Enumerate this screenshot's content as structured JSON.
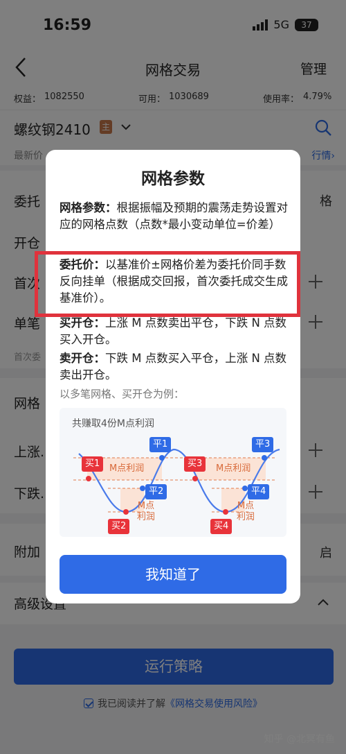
{
  "status": {
    "time": "16:59",
    "network": "5G",
    "battery": "37"
  },
  "nav": {
    "title": "网格交易",
    "manage": "管理"
  },
  "account": {
    "equity_label": "权益：",
    "equity": "1082550",
    "available_label": "可用：",
    "available": "1030689",
    "usage_label": "使用率：",
    "usage": "4.79%"
  },
  "contract": {
    "name": "螺纹钢2410",
    "tag": "主"
  },
  "price": {
    "latest_label": "最新价",
    "quote_link": "行情›"
  },
  "form": {
    "row1": "委托",
    "row1_right": "格",
    "row2": "开仓",
    "row3": "首次",
    "row4": "单笔",
    "row5": "首次委",
    "section": "网格",
    "up": "上涨.",
    "down": "下跌.",
    "extra": "附加",
    "extra_right": "启",
    "advanced": "高级设置"
  },
  "run_button": "运行策略",
  "agreement": {
    "prefix": "我已阅读并了解",
    "link": "《网格交易使用风险》"
  },
  "watermark": "知乎 @北冥有鱼",
  "modal": {
    "title": "网格参数",
    "p1_head": "网格参数：",
    "p1_body": "根据振幅及预期的震荡走势设置对应的网格点数（点数*最小变动单位=价差）",
    "p2_head": "委托价：",
    "p2_body": "以基准价±网格价差为委托价同手数反向挂单（根据成交回报，首次委托成交生成基准价）。",
    "p3_head": "买开仓：",
    "p3_body": "上涨 M 点数卖出平仓，下跌 N 点数买入开仓。",
    "p4_head": "卖开仓：",
    "p4_body": "下跌 M 点数买入平仓，上涨 N 点数卖出开仓。",
    "caption": "以多笔网格、买开仓为例：",
    "diagram_title": "共赚取4份M点利润",
    "tags": {
      "b1": "买1",
      "b2": "买2",
      "b3": "买3",
      "b4": "买4",
      "c1": "平1",
      "c2": "平2",
      "c3": "平3",
      "c4": "平4"
    },
    "profit1": "M点利润",
    "profit2": "M点利润",
    "small_profit1": "M点\n利润",
    "small_profit2": "M点\n利润",
    "ok_button": "我知道了"
  },
  "colors": {
    "accent": "#2f6be6",
    "buy": "#e8333a",
    "highlight": "#e0323c",
    "profit": "#d86a3a"
  }
}
